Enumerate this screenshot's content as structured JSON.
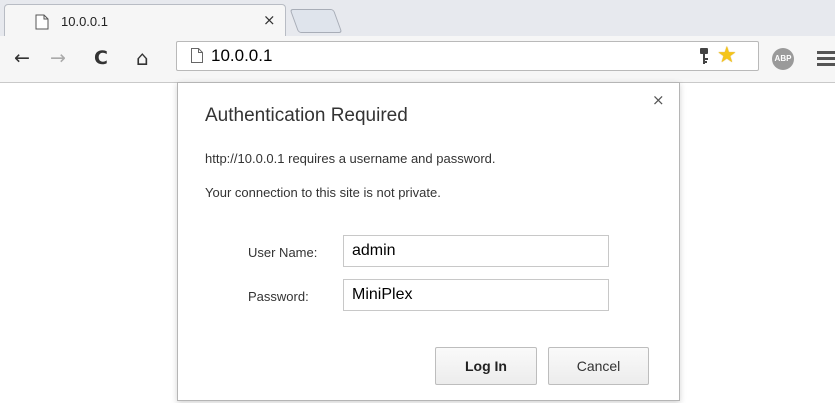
{
  "tab": {
    "title": "10.0.0.1",
    "close_glyph": "×",
    "favicon": "page-icon"
  },
  "toolbar": {
    "back_glyph": "←",
    "forward_glyph": "→",
    "reload_glyph": "C",
    "home_glyph": "⌂",
    "url": "10.0.0.1",
    "star_glyph": "★",
    "abp_label": "ABP"
  },
  "dialog": {
    "title": "Authentication Required",
    "message": "http://10.0.0.1 requires a username and password.",
    "privacy_notice": "Your connection to this site is not private.",
    "username_label": "User Name:",
    "username_value": "admin",
    "password_label": "Password:",
    "password_value": "MiniPlex",
    "login_label": "Log In",
    "cancel_label": "Cancel",
    "close_glyph": "×"
  },
  "colors": {
    "star": "#f5c518",
    "tabstrip": "#e7e9ee",
    "toolbar": "#f6f6f6"
  }
}
